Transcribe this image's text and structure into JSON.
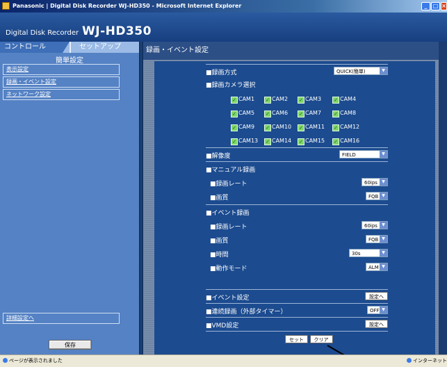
{
  "window": {
    "title": "Panasonic | Digital Disk Recorder WJ-HD350 - Microsoft Internet Explorer",
    "minimize": "_",
    "maximize": "□",
    "close": "×"
  },
  "header": {
    "brand": "Digital Disk Recorder",
    "model": "WJ-HD350"
  },
  "tabs": {
    "control": "コントロール",
    "setup": "セットアップ"
  },
  "sidebar": {
    "section_title": "簡単設定",
    "items": [
      "表示設定",
      "録画・イベント設定",
      "ネットワーク設定"
    ],
    "advanced": "詳細設定へ",
    "save": "保存"
  },
  "main": {
    "title": "録画・イベント設定",
    "rec_method": {
      "label": "■録画方式",
      "value": "QUICK(簡単)"
    },
    "cam_select": {
      "label": "■録画カメラ選択"
    },
    "cameras": [
      "CAM1",
      "CAM2",
      "CAM3",
      "CAM4",
      "CAM5",
      "CAM6",
      "CAM7",
      "CAM8",
      "CAM9",
      "CAM10",
      "CAM11",
      "CAM12",
      "CAM13",
      "CAM14",
      "CAM15",
      "CAM16"
    ],
    "resolution": {
      "label": "■解像度",
      "value": "FIELD"
    },
    "manual": {
      "label": "■マニュアル録画",
      "rate_label": "■録画レート",
      "rate_value": "60ips",
      "quality_label": "■画質",
      "quality_value": "FQB"
    },
    "event": {
      "label": "■イベント録画",
      "rate_label": "■録画レート",
      "rate_value": "60ips",
      "quality_label": "■画質",
      "quality_value": "FQB",
      "time_label": "■時間",
      "time_value": "30s",
      "mode_label": "■動作モード",
      "mode_value": "ALM"
    },
    "event_settings": {
      "label": "■イベント設定",
      "button": "設定へ"
    },
    "continuous": {
      "label": "■連続録画（外部タイマー）",
      "value": "OFF"
    },
    "vmd": {
      "label": "■VMD設定",
      "button": "設定へ"
    },
    "set_button": "セット",
    "clear_button": "クリア"
  },
  "statusbar": {
    "left": "ページが表示されました",
    "zone": "インターネット"
  },
  "colors": {
    "panel": "#1c4b8f",
    "sidebar": "#5582c4",
    "check": "#7fd56a"
  }
}
